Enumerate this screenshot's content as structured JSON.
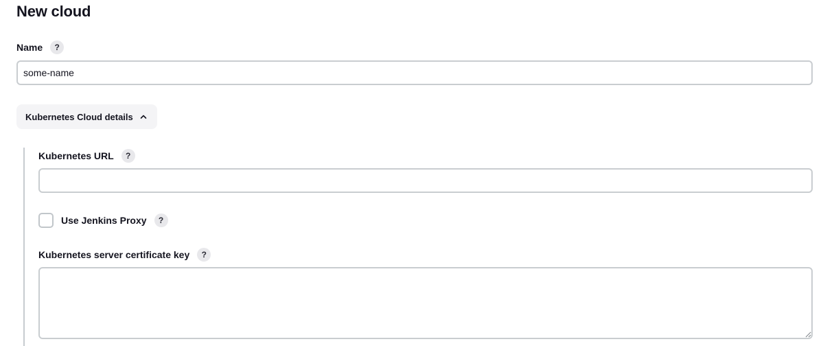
{
  "page": {
    "title": "New cloud"
  },
  "name_field": {
    "label": "Name",
    "help": "?",
    "value": "some-name"
  },
  "section": {
    "title": "Kubernetes Cloud details",
    "expanded": true
  },
  "url_field": {
    "label": "Kubernetes URL",
    "help": "?",
    "value": ""
  },
  "proxy_checkbox": {
    "label": "Use Jenkins Proxy",
    "help": "?",
    "checked": false
  },
  "cert_field": {
    "label": "Kubernetes server certificate key",
    "help": "?",
    "value": ""
  },
  "icons": {
    "help": "question-mark-icon",
    "toggle": "chevron-up-icon",
    "grip": "resize-grip-icon"
  },
  "colors": {
    "border": "#c9cdd0",
    "section_bg": "#f4f4f6",
    "help_bg": "#e8e8eb",
    "text": "#14141f"
  }
}
